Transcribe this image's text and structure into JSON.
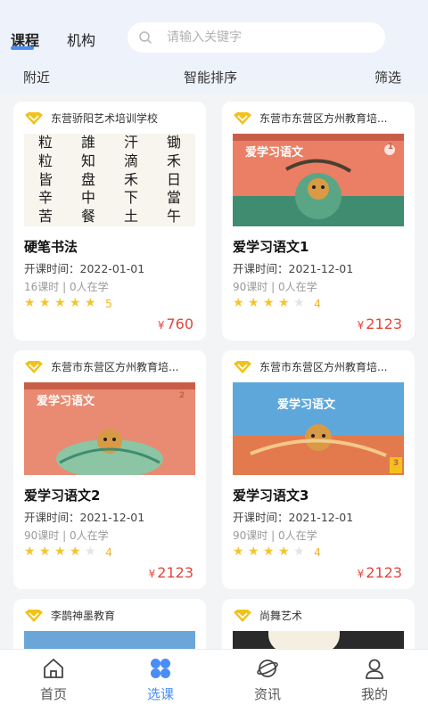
{
  "header": {
    "tabs": [
      {
        "label": "课程",
        "active": true
      },
      {
        "label": "机构",
        "active": false
      }
    ],
    "search": {
      "placeholder": "请输入关键字",
      "icon": "search-icon"
    }
  },
  "filters": {
    "nearby": "附近",
    "sort": "智能排序",
    "filter": "筛选"
  },
  "courses": [
    {
      "school": "东营骄阳艺术培训学校",
      "title": "硬笔书法",
      "date": "开课时间：2022-01-01",
      "hours": "16课时 | 0人在学",
      "stars": 5,
      "rating": "5",
      "currency": "¥",
      "price": "760",
      "calligraphy": [
        "粒",
        "誰",
        "汗",
        "锄",
        "粒",
        "知",
        "滴",
        "禾",
        "皆",
        "盘",
        "禾",
        "日",
        "辛",
        "中",
        "下",
        "當",
        "苦",
        "餐",
        "土",
        "午"
      ]
    },
    {
      "school": "东营市东营区方州教育培...",
      "title": "爱学习语文1",
      "date": "开课时间：2021-12-01",
      "hours": "90课时 | 0人在学",
      "stars": 4,
      "rating": "4",
      "currency": "¥",
      "price": "2123",
      "book_title": "爱学习语文",
      "book_no": "1"
    },
    {
      "school": "东营市东营区方州教育培...",
      "title": "爱学习语文2",
      "date": "开课时间：2021-12-01",
      "hours": "90课时 | 0人在学",
      "stars": 4,
      "rating": "4",
      "currency": "¥",
      "price": "2123",
      "book_title": "爱学习语文",
      "book_no": "2"
    },
    {
      "school": "东营市东营区方州教育培...",
      "title": "爱学习语文3",
      "date": "开课时间：2021-12-01",
      "hours": "90课时 | 0人在学",
      "stars": 4,
      "rating": "4",
      "currency": "¥",
      "price": "2123",
      "book_title": "爱学习语文",
      "book_no": "3"
    },
    {
      "school": "李鹊神墨教育"
    },
    {
      "school": "尚舞艺术"
    }
  ],
  "nav": [
    {
      "label": "首页",
      "icon": "home-icon",
      "active": false
    },
    {
      "label": "选课",
      "icon": "course-select-icon",
      "active": true
    },
    {
      "label": "资讯",
      "icon": "news-icon",
      "active": false
    },
    {
      "label": "我的",
      "icon": "profile-icon",
      "active": false
    }
  ],
  "colors": {
    "accent": "#4a8df6",
    "price": "#e2463c",
    "star": "#f4c430",
    "badge": "#f2c21a"
  }
}
